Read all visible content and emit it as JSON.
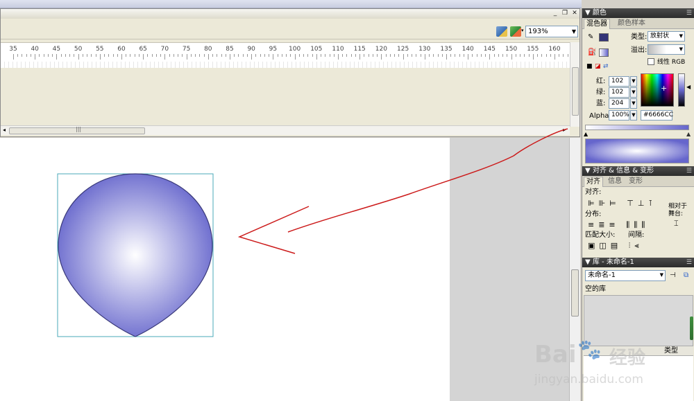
{
  "zoom": "193%",
  "ruler": {
    "ticks": [
      "35",
      "40",
      "45",
      "50",
      "55",
      "60",
      "65",
      "70",
      "75",
      "80",
      "85",
      "90",
      "95",
      "100",
      "105",
      "110",
      "115",
      "120",
      "125",
      "130",
      "135",
      "140",
      "145",
      "150",
      "155",
      "160"
    ]
  },
  "color_panel": {
    "title": "颜色",
    "tabs": [
      "混色器",
      "颜色样本"
    ],
    "type_label": "类型:",
    "type_value": "放射状",
    "overflow_label": "溢出:",
    "linear_rgb": "线性 RGB",
    "red_label": "红:",
    "red_value": "102",
    "green_label": "绿:",
    "green_value": "102",
    "blue_label": "蓝:",
    "blue_value": "204",
    "alpha_label": "Alpha:",
    "alpha_value": "100%",
    "hex_value": "#6666CC",
    "start_color": "#ffffff",
    "end_color": "#6666cc"
  },
  "align_panel": {
    "title": "对齐 & 信息 & 变形",
    "tabs": [
      "对齐",
      "信息",
      "变形"
    ],
    "align_label": "对齐:",
    "distribute_label": "分布:",
    "match_size_label": "匹配大小:",
    "spacing_label": "间隔:",
    "to_stage_label_1": "相对于",
    "to_stage_label_2": "舞台:"
  },
  "library_panel": {
    "title": "库 - 未命名-1",
    "doc_select": "未命名-1",
    "empty_text": "空的库",
    "col_type": "类型"
  },
  "watermark": {
    "brand": "Bai",
    "brand2": "经验",
    "url": "jingyan.baidu.com"
  }
}
